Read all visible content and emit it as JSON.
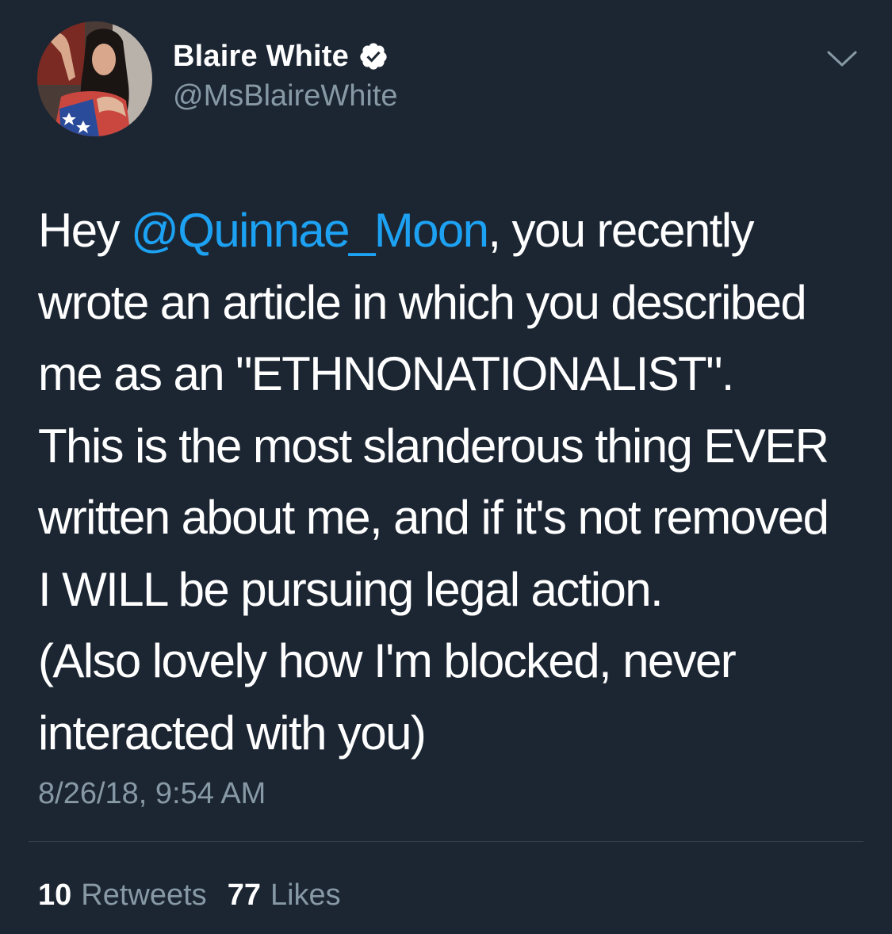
{
  "tweet": {
    "author": {
      "display_name": "Blaire White",
      "handle": "@MsBlaireWhite",
      "verified": true,
      "avatar_icon": "profile-photo"
    },
    "menu_icon": "chevron-down-icon",
    "body": {
      "line1_pre": "Hey ",
      "mention": "@Quinnae_Moon",
      "line1_post": ", you recently",
      "line2": "wrote an article in which you described",
      "line3": "me as an \"ETHNONATIONALIST\".",
      "line4": "This is the most slanderous thing EVER",
      "line5": "written about me, and if it's not removed",
      "line6": "I WILL be pursuing legal action.",
      "line7": "(Also lovely how I'm blocked, never",
      "line8": "interacted with you)"
    },
    "timestamp": "8/26/18, 9:54 AM",
    "stats": {
      "retweets_count": "10",
      "retweets_label": "Retweets",
      "likes_count": "77",
      "likes_label": "Likes"
    }
  },
  "colors": {
    "background": "#1c2633",
    "text": "#ffffff",
    "secondary": "#8899a6",
    "link": "#1da1f2",
    "divider": "#38444d"
  }
}
